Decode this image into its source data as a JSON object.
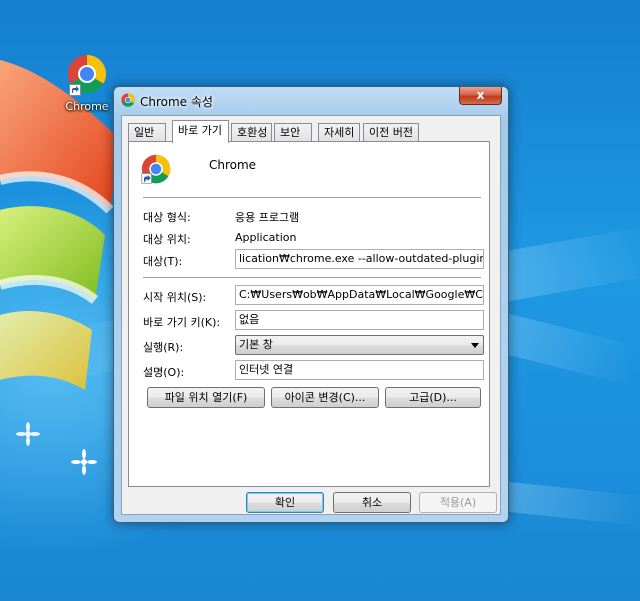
{
  "desktop": {
    "shortcut_label": "Chrome"
  },
  "window": {
    "title": "Chrome 속성",
    "close_glyph": "x",
    "tabs": [
      {
        "label": "일반"
      },
      {
        "label": "바로 가기"
      },
      {
        "label": "호환성"
      },
      {
        "label": "보안"
      },
      {
        "label": "자세히"
      },
      {
        "label": "이전 버전"
      }
    ],
    "active_tab": "바로 가기",
    "shortcut": {
      "app_name": "Chrome",
      "target_type_label": "대상 형식:",
      "target_type_value": "응용 프로그램",
      "target_location_label": "대상 위치:",
      "target_location_value": "Application",
      "target_label": "대상(T):",
      "target_value": "lication₩chrome.exe --allow-outdated-plugins",
      "start_in_label": "시작 위치(S):",
      "start_in_value": "C:₩Users₩ob₩AppData₩Local₩Google₩Chrome₩",
      "shortcut_key_label": "바로 가기 키(K):",
      "shortcut_key_value": "없음",
      "run_label": "실행(R):",
      "run_value": "기본 창",
      "comment_label": "설명(O):",
      "comment_value": "인터넷 연결",
      "open_location_button": "파일 위치 열기(F)",
      "change_icon_button": "아이콘 변경(C)...",
      "advanced_button": "고급(D)..."
    },
    "footer": {
      "ok_button": "확인",
      "cancel_button": "취소",
      "apply_button": "적용(A)"
    }
  },
  "colors": {
    "desktop_blue": "#1d8fd8",
    "close_red": "#c1391c",
    "frame_glass": "#aacdeb"
  }
}
